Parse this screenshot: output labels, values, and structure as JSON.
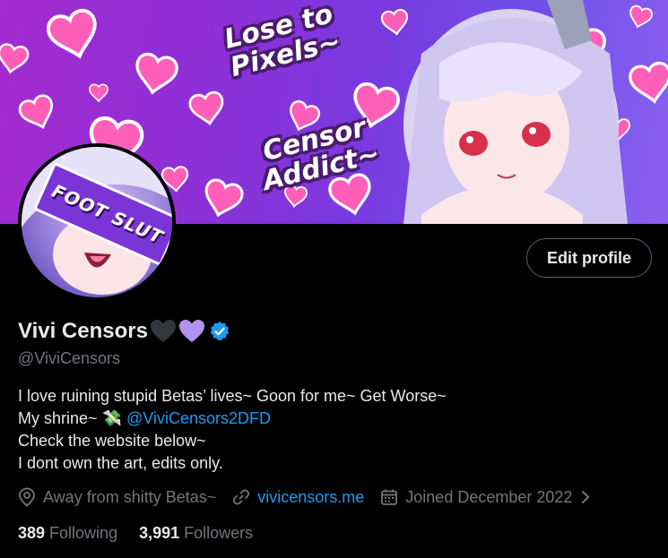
{
  "banner": {
    "text_line1": "Lose to",
    "text_line2": "Pixels~",
    "text_line3": "Censor",
    "text_line4": "Addict~"
  },
  "avatar": {
    "censor_text": "FOOT SLUT"
  },
  "actions": {
    "edit_profile_label": "Edit profile"
  },
  "profile": {
    "display_name": "Vivi Censors",
    "handle": "@ViviCensors",
    "verified": true
  },
  "bio": {
    "line1": "I love ruining stupid Betas’ lives~ Goon for me~ Get Worse~",
    "line2_prefix": "My shrine~",
    "line2_emoji": "💸",
    "line2_mention": "@ViviCensors2DFD",
    "line3": "Check the website below~",
    "line4": "I dont own the art, edits only."
  },
  "meta": {
    "location": "Away from shitty Betas~",
    "website": "vivicensors.me",
    "joined": "Joined December 2022"
  },
  "stats": {
    "following_count": "389",
    "following_label": "Following",
    "followers_count": "3,991",
    "followers_label": "Followers"
  },
  "colors": {
    "accent_blue": "#1d9bf0",
    "muted_text": "#71767b",
    "heart_purple": "#b392f0",
    "heart_black": "#31373d"
  },
  "icons": [
    "location-icon",
    "link-icon",
    "calendar-icon",
    "chevron-right-icon",
    "verified-badge-icon"
  ]
}
